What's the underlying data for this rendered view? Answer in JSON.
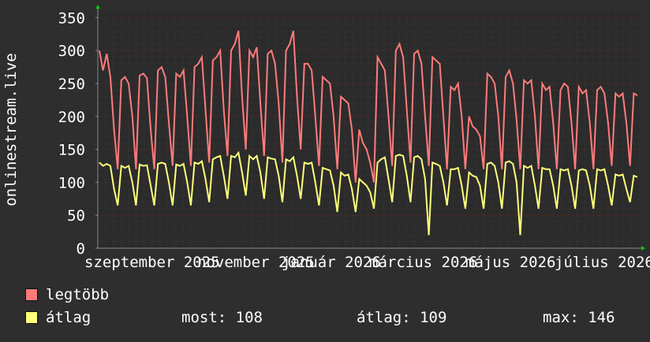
{
  "chart_data": {
    "type": "line",
    "ylabel": "onlinestream.live",
    "ylim": [
      0,
      360
    ],
    "yticks": [
      0,
      50,
      100,
      150,
      200,
      250,
      300,
      350
    ],
    "xtick_labels": [
      "szeptember 2025",
      "november 2025",
      "január 2026",
      "március 2026",
      "május 2026",
      "július 2026"
    ],
    "grid": true,
    "legend_placement": "bottom",
    "colors": {
      "background": "#2e2e2e",
      "plot_background": "#2b2b2b",
      "major_grid": "#5c2a2a",
      "minor_grid": "#3a3a3a",
      "axis": "#8a8a8a",
      "arrow": "#00cc00",
      "series_max": "#ff7b7b",
      "series_avg": "#ffff7a"
    },
    "series": [
      {
        "name": "legtöbb",
        "color": "#ff7b7b",
        "description": "daily peak with weekly dips",
        "max_approx": 330,
        "typical_peak": 270,
        "typical_trough": 120,
        "values": [
          300,
          270,
          295,
          260,
          180,
          120,
          255,
          260,
          250,
          200,
          120,
          262,
          265,
          258,
          180,
          120,
          270,
          275,
          260,
          190,
          125,
          265,
          260,
          270,
          200,
          125,
          275,
          280,
          290,
          210,
          130,
          285,
          290,
          300,
          210,
          140,
          300,
          310,
          330,
          230,
          150,
          300,
          290,
          305,
          220,
          140,
          295,
          300,
          280,
          220,
          130,
          300,
          310,
          330,
          230,
          150,
          280,
          280,
          270,
          200,
          125,
          260,
          255,
          250,
          200,
          120,
          230,
          225,
          220,
          180,
          100,
          180,
          160,
          150,
          130,
          100,
          290,
          280,
          270,
          200,
          125,
          300,
          310,
          290,
          210,
          130,
          295,
          300,
          280,
          200,
          125,
          290,
          285,
          280,
          200,
          120,
          245,
          240,
          250,
          200,
          120,
          200,
          185,
          180,
          170,
          120,
          265,
          260,
          250,
          200,
          120,
          260,
          270,
          250,
          195,
          120,
          255,
          250,
          255,
          200,
          120,
          250,
          240,
          245,
          190,
          120,
          240,
          250,
          245,
          190,
          120,
          245,
          235,
          240,
          190,
          120,
          240,
          245,
          235,
          190,
          125,
          235,
          230,
          235,
          190,
          125,
          235,
          232
        ]
      },
      {
        "name": "átlag",
        "color": "#ffff7a",
        "description": "daily average with weekly dips",
        "most": 108,
        "atlag": 109,
        "max": 146,
        "values": [
          130,
          125,
          128,
          125,
          90,
          65,
          125,
          122,
          125,
          100,
          65,
          127,
          125,
          126,
          95,
          65,
          128,
          130,
          128,
          100,
          65,
          127,
          125,
          128,
          100,
          65,
          130,
          128,
          132,
          105,
          70,
          135,
          138,
          140,
          110,
          75,
          140,
          138,
          145,
          115,
          80,
          140,
          135,
          140,
          115,
          75,
          138,
          136,
          135,
          110,
          70,
          135,
          132,
          138,
          110,
          75,
          130,
          128,
          130,
          100,
          65,
          122,
          120,
          118,
          95,
          55,
          115,
          110,
          112,
          90,
          55,
          105,
          100,
          95,
          85,
          60,
          130,
          135,
          138,
          105,
          70,
          140,
          142,
          140,
          110,
          70,
          138,
          140,
          135,
          105,
          20,
          130,
          128,
          125,
          100,
          65,
          120,
          120,
          122,
          95,
          60,
          115,
          110,
          108,
          95,
          60,
          128,
          130,
          125,
          100,
          60,
          130,
          132,
          128,
          100,
          20,
          125,
          122,
          125,
          95,
          60,
          122,
          120,
          120,
          95,
          60,
          120,
          118,
          120,
          95,
          60,
          118,
          120,
          118,
          95,
          60,
          120,
          118,
          120,
          95,
          65,
          112,
          110,
          112,
          90,
          70,
          110,
          108
        ]
      }
    ]
  },
  "legend": {
    "max_label": "legtöbb",
    "avg_label": "átlag",
    "most_text": "most: 108",
    "atlag_text": "átlag: 109",
    "max_text": "max: 146"
  }
}
